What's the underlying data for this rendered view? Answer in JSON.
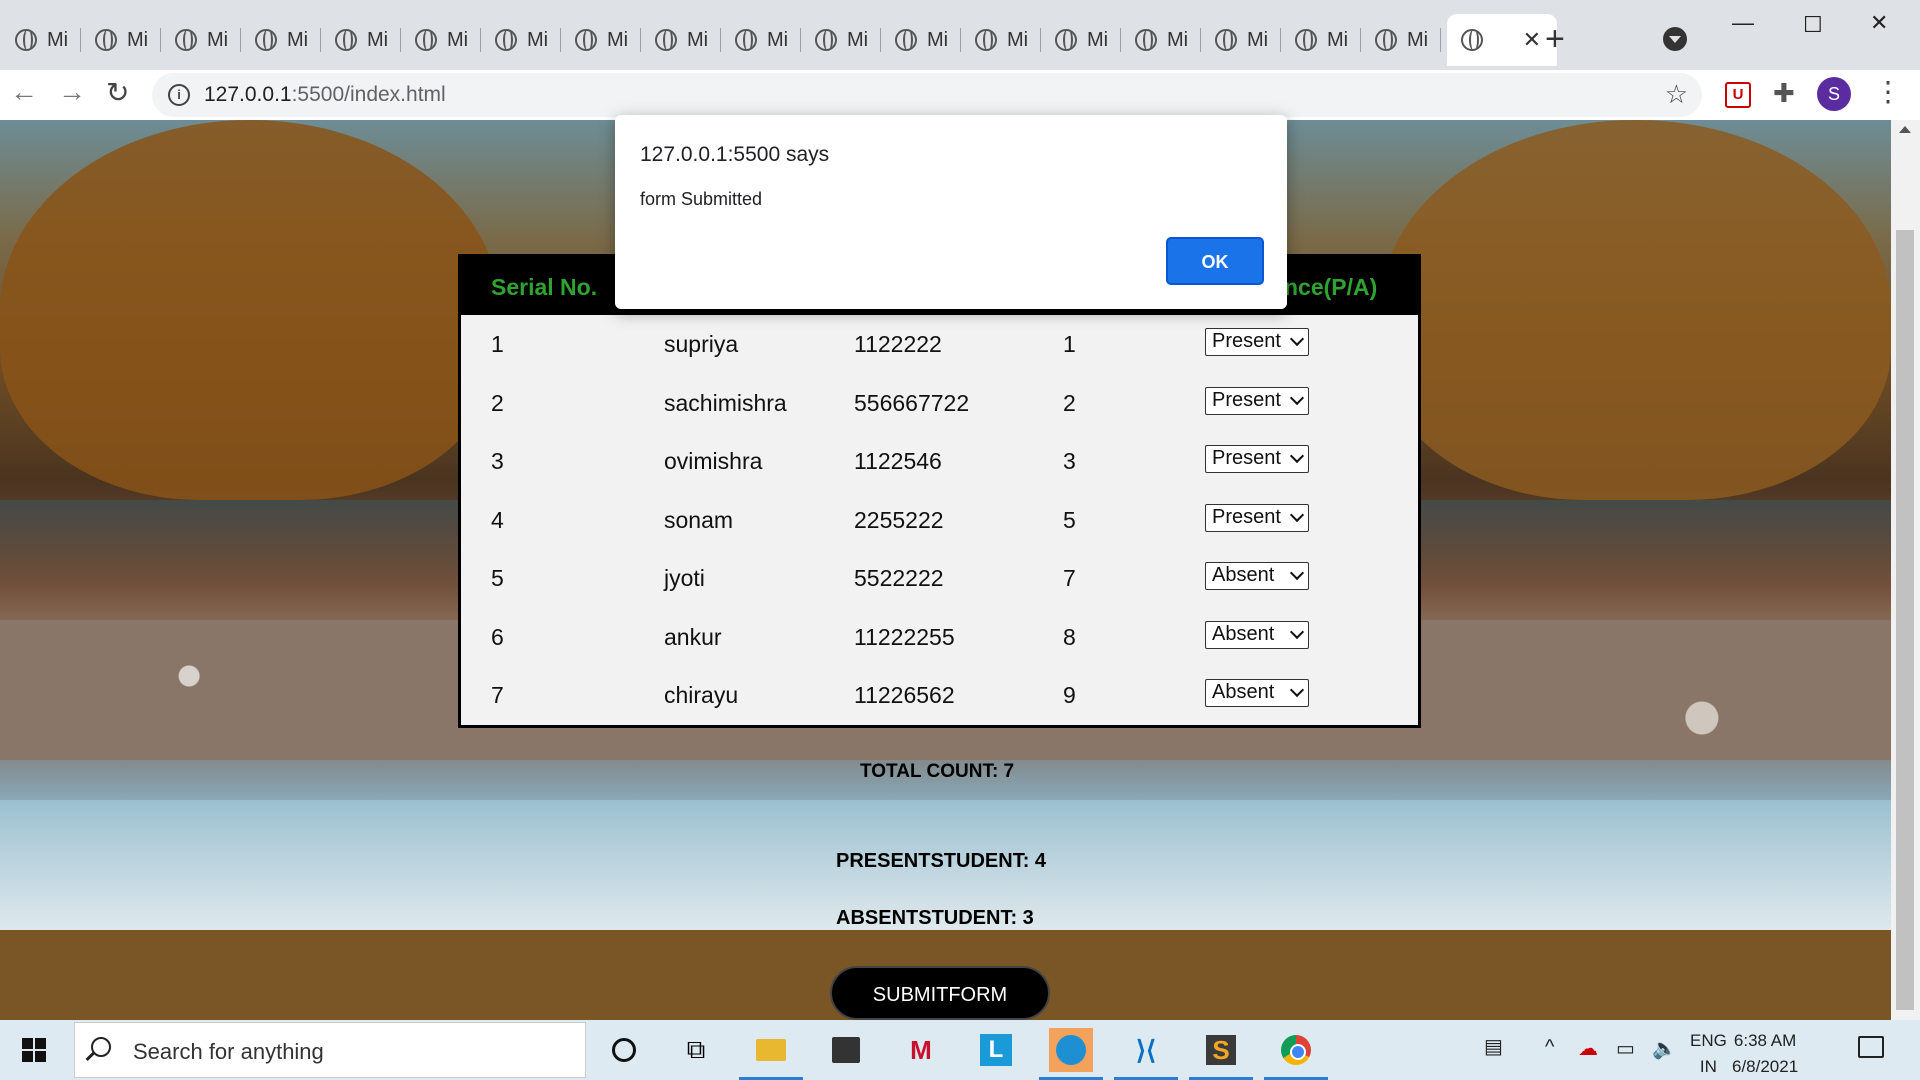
{
  "browser": {
    "tab_label": "Mi",
    "tab_count_inactive": 18,
    "url_host": "127.0.0.1",
    "url_rest": ":5500/index.html",
    "profile_initial": "S"
  },
  "dialog": {
    "title": "127.0.0.1:5500 says",
    "message": "form Submitted",
    "ok_label": "OK"
  },
  "table": {
    "headers": [
      "Serial No.",
      "nce(P/A)"
    ],
    "rows": [
      {
        "serial": "1",
        "name": "supriya",
        "number": "1122222",
        "roll": "1",
        "status": "Present"
      },
      {
        "serial": "2",
        "name": "sachimishra",
        "number": "556667722",
        "roll": "2",
        "status": "Present"
      },
      {
        "serial": "3",
        "name": "ovimishra",
        "number": "1122546",
        "roll": "3",
        "status": "Present"
      },
      {
        "serial": "4",
        "name": "sonam",
        "number": "2255222",
        "roll": "5",
        "status": "Present"
      },
      {
        "serial": "5",
        "name": "jyoti",
        "number": "5522222",
        "roll": "7",
        "status": "Absent"
      },
      {
        "serial": "6",
        "name": "ankur",
        "number": "11222255",
        "roll": "8",
        "status": "Absent"
      },
      {
        "serial": "7",
        "name": "chirayu",
        "number": "11226562",
        "roll": "9",
        "status": "Absent"
      }
    ]
  },
  "summary": {
    "total": "TOTAL COUNT: 7",
    "present": "PRESENTSTUDENT: 4",
    "absent": "ABSENTSTUDENT: 3",
    "submit_label": "SUBMITFORM"
  },
  "taskbar": {
    "search_placeholder": "Search for anything",
    "lang_top": "ENG",
    "lang_bottom": "IN",
    "time": "6:38 AM",
    "date": "6/8/2021"
  }
}
